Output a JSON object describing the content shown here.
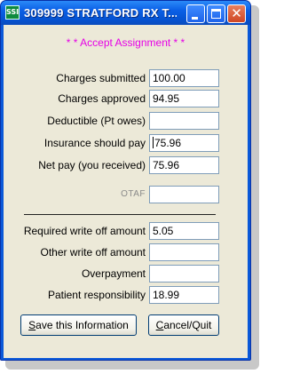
{
  "window": {
    "title": "309999 STRATFORD RX T...",
    "app_icon_text": "SSI",
    "minimize_icon": "minimize-icon",
    "maximize_icon": "maximize-icon",
    "close_glyph": "✕"
  },
  "header": {
    "text": "* * Accept Assignment * *"
  },
  "rows": [
    {
      "label": "Charges submitted",
      "value": "100.00"
    },
    {
      "label": "Charges approved",
      "value": "94.95"
    },
    {
      "label": "Deductible (Pt owes)",
      "value": ""
    },
    {
      "label": "Insurance should pay",
      "value": "75.96"
    },
    {
      "label": "Net pay (you received)",
      "value": "75.96"
    },
    {
      "label": "OTAF",
      "value": ""
    },
    {
      "label": "Required write off amount",
      "value": "5.05"
    },
    {
      "label": "Other write off amount",
      "value": ""
    },
    {
      "label": "Overpayment",
      "value": ""
    },
    {
      "label": "Patient responsibility",
      "value": "18.99"
    }
  ],
  "buttons": {
    "save_mnemonic": "S",
    "save_rest": "ave this Information",
    "cancel_mnemonic": "C",
    "cancel_rest": "ancel/Quit"
  },
  "colors": {
    "title_bar": "#0a5fe6",
    "header_text": "#e600e6",
    "client_bg": "#ece9d8"
  }
}
